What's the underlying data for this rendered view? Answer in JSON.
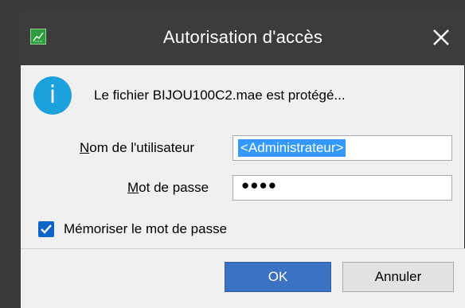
{
  "window": {
    "title": "Autorisation d'accès",
    "app_icon": "chart-app-icon",
    "close_icon": "close-icon"
  },
  "message": {
    "icon": "info-icon",
    "icon_glyph": "i",
    "text": "Le fichier BIJOU100C2.mae est protégé..."
  },
  "form": {
    "username_label_mnemonic": "N",
    "username_label_rest": "om de l'utilisateur",
    "username_value": "<Administrateur>",
    "password_label_mnemonic": "M",
    "password_label_rest": "ot de passe",
    "password_value": "●●●●",
    "remember_label": "Mémoriser le mot de passe",
    "remember_checked": true
  },
  "buttons": {
    "ok": "OK",
    "cancel": "Annuler"
  },
  "colors": {
    "titlebar": "#3c3c3c",
    "accent": "#3c72c1",
    "info": "#1da1dd",
    "selection": "#3399ff"
  }
}
